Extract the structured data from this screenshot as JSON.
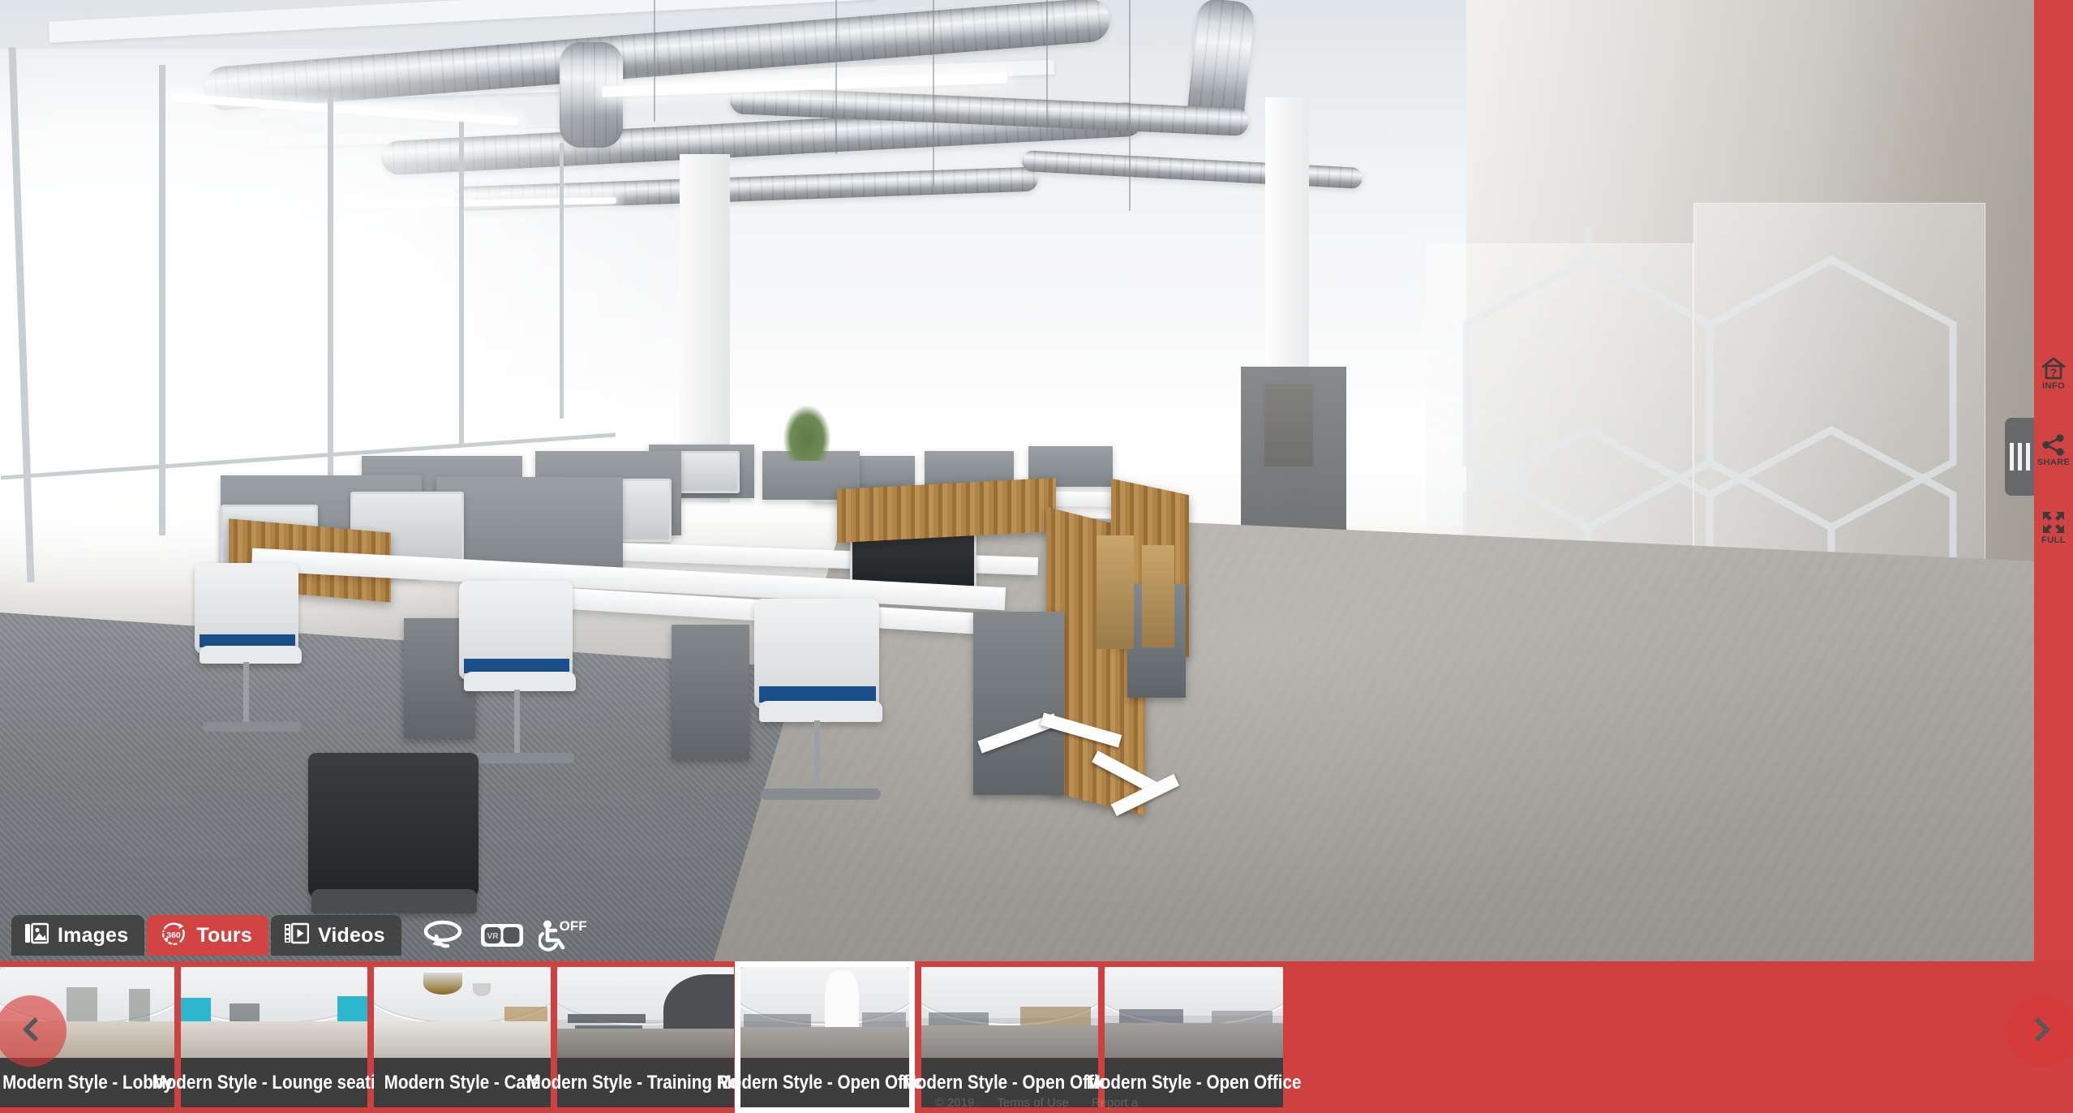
{
  "viewer": {
    "scene_title": "Modern Style - Open Office",
    "accent_color": "#d24344",
    "strip_color": "#cf4040",
    "caption_bg": "#3d3d3d"
  },
  "toolbar": {
    "tabs": [
      {
        "id": "images",
        "label": "Images",
        "icon": "image-icon",
        "active": false
      },
      {
        "id": "tours",
        "label": "Tours",
        "icon": "360-icon",
        "active": true
      },
      {
        "id": "videos",
        "label": "Videos",
        "icon": "film-icon",
        "active": false
      }
    ],
    "tools": [
      {
        "id": "autorotate",
        "icon": "autorotate-icon",
        "label": ""
      },
      {
        "id": "vr",
        "icon": "vr-goggles-icon",
        "label": ""
      },
      {
        "id": "accessibility",
        "icon": "accessibility-icon",
        "label": "OFF"
      }
    ]
  },
  "rail": {
    "buttons": [
      {
        "id": "info",
        "label": "INFO",
        "icon": "house-question-icon"
      },
      {
        "id": "share",
        "label": "SHARE",
        "icon": "share-nodes-icon"
      },
      {
        "id": "full",
        "label": "FULL",
        "icon": "expand-arrows-icon"
      }
    ],
    "handle_icon": "drag-handle-icon"
  },
  "filmstrip": {
    "prev_label": "◀",
    "next_label": "▶",
    "thumbnails": [
      {
        "label": "Modern Style - Lobby",
        "selected": false
      },
      {
        "label": "Modern Style - Lounge seating",
        "selected": false
      },
      {
        "label": "Modern Style - Café",
        "selected": false
      },
      {
        "label": "Modern Style - Training Room",
        "selected": false
      },
      {
        "label": "Modern Style - Open Office",
        "selected": true
      },
      {
        "label": "Modern Style - Open Office",
        "selected": false
      },
      {
        "label": "Modern Style - Open Office",
        "selected": false
      }
    ]
  },
  "footer_ghost": {
    "items": [
      "© 2019",
      "Terms of Use",
      "Report a"
    ]
  }
}
